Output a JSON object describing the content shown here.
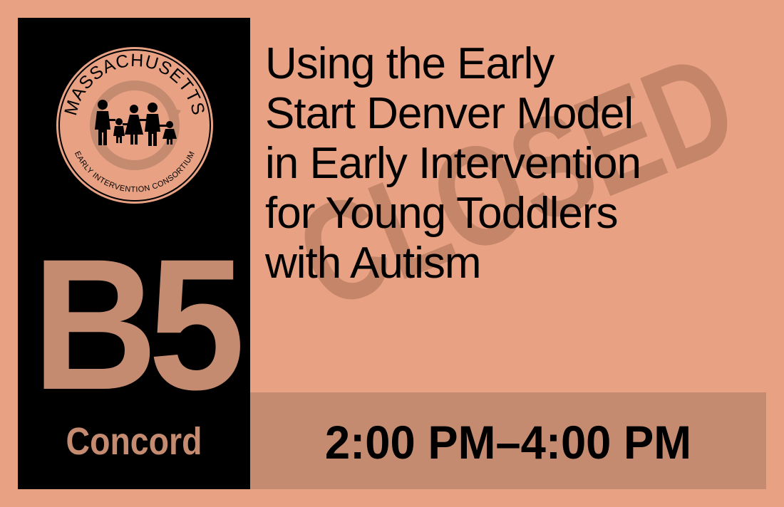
{
  "logo": {
    "top_text": "MASSACHUSETTS",
    "bottom_text": "EARLY INTERVENTION CONSORTIUM",
    "icon": "family-icon"
  },
  "session_code": "B5",
  "location": "Concord",
  "title_lines": [
    "Using the Early",
    "Start Denver Model",
    "in Early Intervention",
    "for Young Toddlers",
    "with Autism"
  ],
  "stamp": "CLOSED",
  "time": "2:00 PM–4:00 PM",
  "colors": {
    "background": "#e8a283",
    "accent": "#c48b70",
    "sidebar": "#000000"
  }
}
